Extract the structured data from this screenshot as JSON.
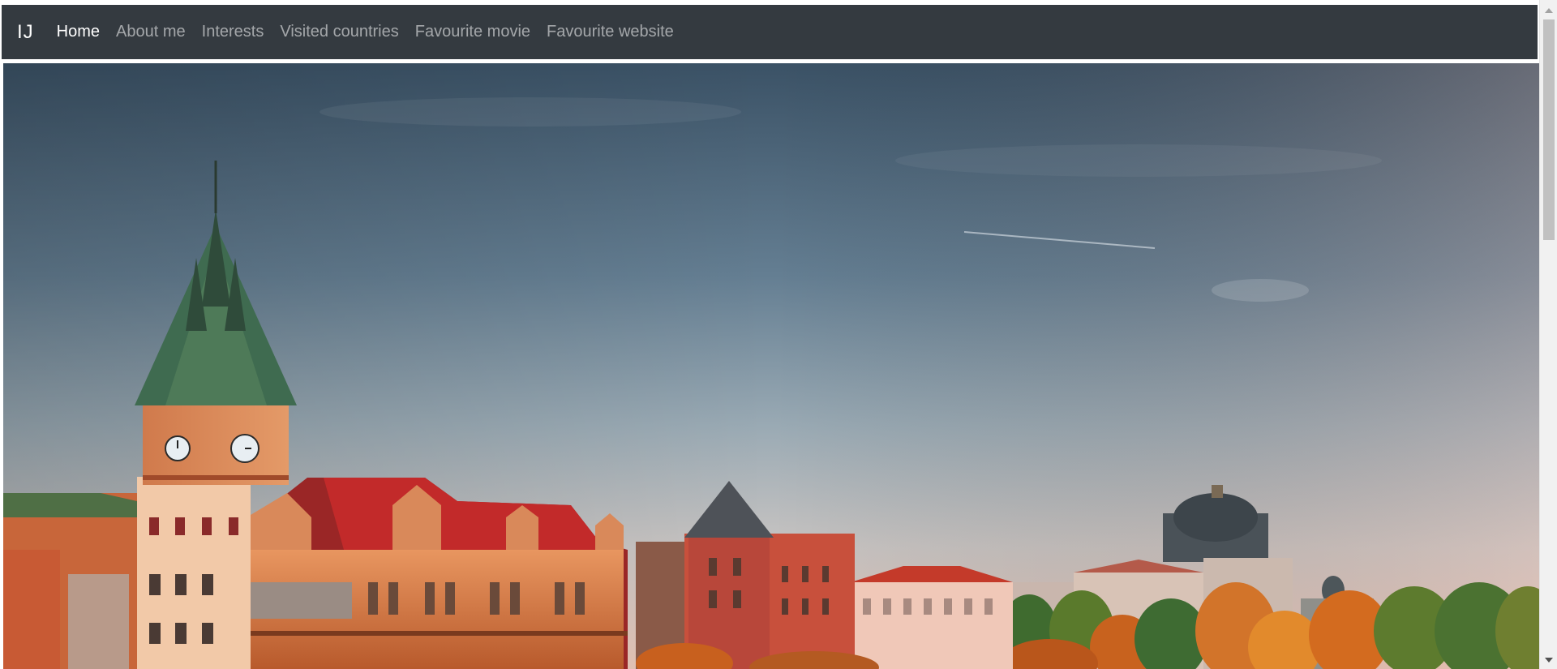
{
  "navbar": {
    "brand": "IJ",
    "links": [
      {
        "label": "Home",
        "active": true
      },
      {
        "label": "About me",
        "active": false
      },
      {
        "label": "Interests",
        "active": false
      },
      {
        "label": "Visited countries",
        "active": false
      },
      {
        "label": "Favourite movie",
        "active": false
      },
      {
        "label": "Favourite website",
        "active": false
      }
    ]
  },
  "hero": {
    "image": "prague-riverside-skyline-photo"
  },
  "colors": {
    "navbar_bg": "#343a40",
    "nav_active": "#ffffff",
    "nav_inactive": "#9a9da0"
  }
}
